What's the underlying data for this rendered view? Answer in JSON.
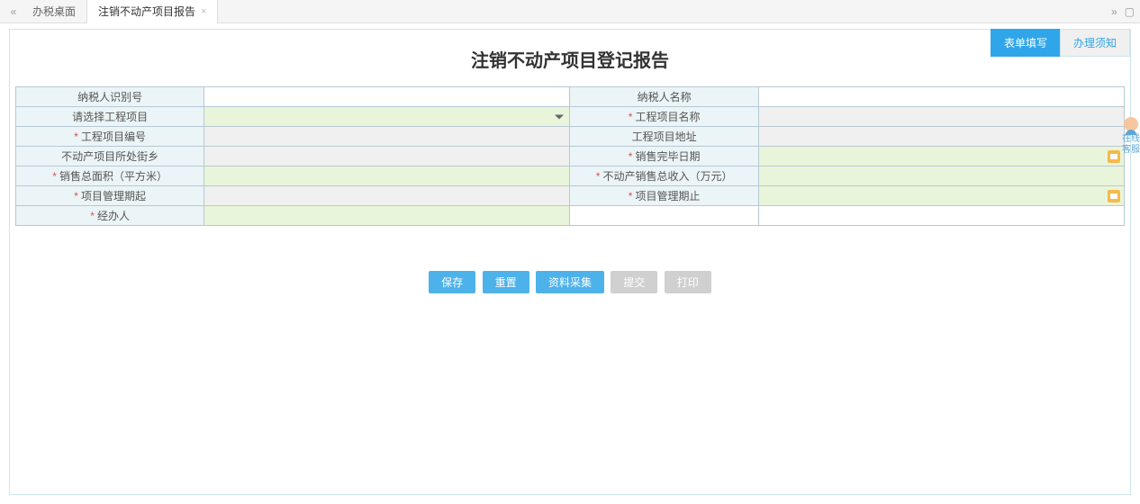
{
  "tabs": {
    "main": "办税桌面",
    "current": "注销不动产项目报告"
  },
  "topTabs": {
    "fill": "表单填写",
    "notice": "办理须知"
  },
  "title": "注销不动产项目登记报告",
  "fields": {
    "taxpayerId": {
      "label": "纳税人识别号",
      "value": ""
    },
    "taxpayerName": {
      "label": "纳税人名称",
      "value": ""
    },
    "selectProject": {
      "label": "请选择工程项目",
      "value": ""
    },
    "projectName": {
      "label": "工程项目名称",
      "value": ""
    },
    "projectNo": {
      "label": "工程项目编号",
      "value": ""
    },
    "projectAddr": {
      "label": "工程项目地址",
      "value": ""
    },
    "street": {
      "label": "不动产项目所处街乡",
      "value": ""
    },
    "saleDoneDate": {
      "label": "销售完毕日期",
      "value": ""
    },
    "totalArea": {
      "label": "销售总面积（平方米）",
      "value": ""
    },
    "totalRevenue": {
      "label": "不动产销售总收入（万元）",
      "value": ""
    },
    "periodStart": {
      "label": "项目管理期起",
      "value": ""
    },
    "periodEnd": {
      "label": "项目管理期止",
      "value": ""
    },
    "operator": {
      "label": "经办人",
      "value": ""
    }
  },
  "buttons": {
    "save": "保存",
    "reset": "重置",
    "collect": "资料采集",
    "submit": "提交",
    "print": "打印"
  },
  "sideHelp": "在线客服"
}
